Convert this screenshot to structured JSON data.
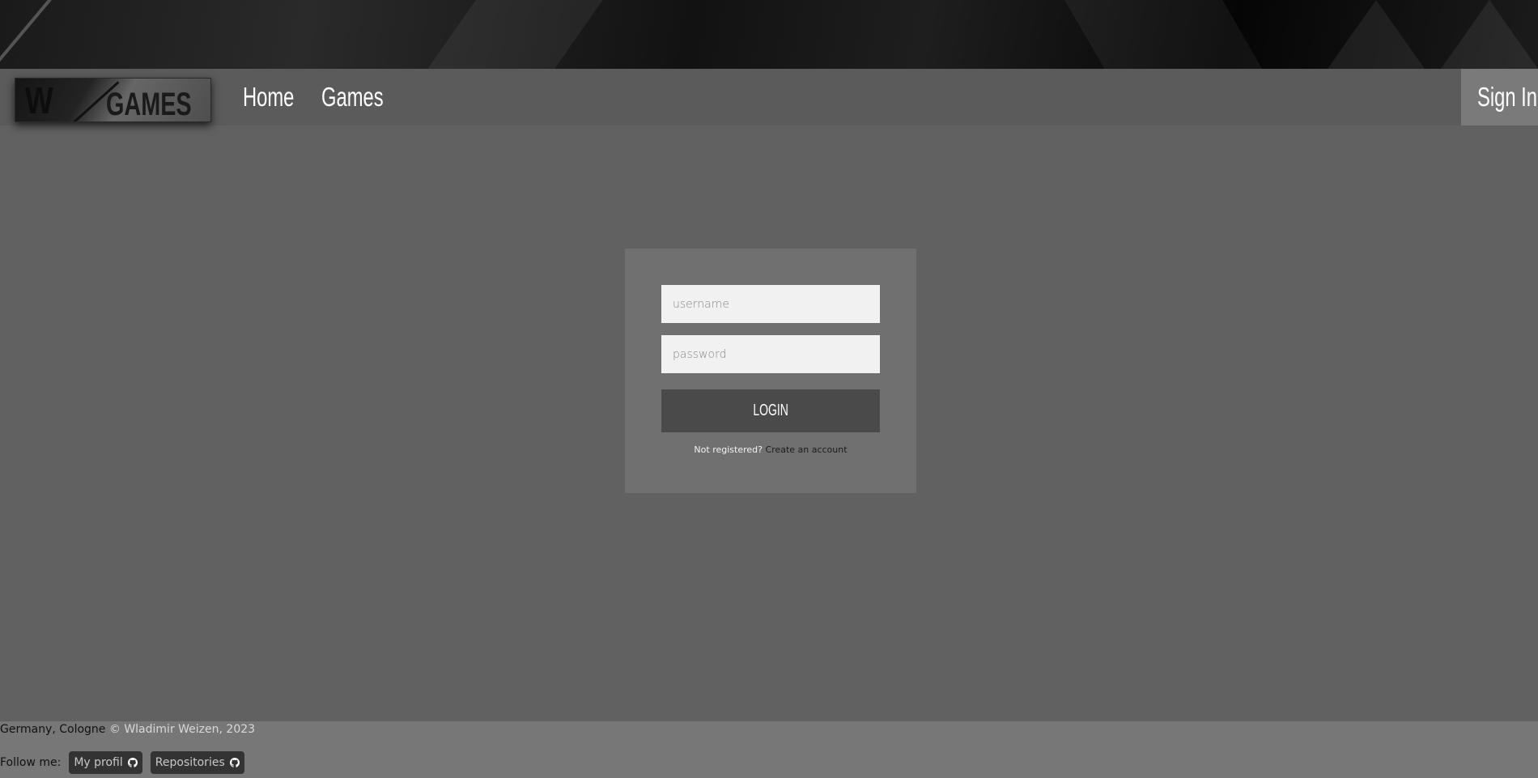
{
  "logo": {
    "letter": "W",
    "word": "GAMES"
  },
  "nav": {
    "home_label": "Home",
    "games_label": "Games",
    "signin_label": "Sign In"
  },
  "login": {
    "username_placeholder": "username",
    "password_placeholder": "password",
    "button_label": "LOGIN",
    "not_registered": "Not registered?",
    "create_account": "Create an account"
  },
  "footer": {
    "location": "Germany, Cologne",
    "copyright": "© Wladimir Weizen, 2023",
    "follow_label": "Follow me:",
    "profile_label": "My profil",
    "repositories_label": "Repositories",
    "link_icon": "github-icon"
  },
  "colors": {
    "page_bg": "#616161",
    "nav_bg": "#5b5b5b",
    "card_bg": "#707070",
    "button_bg": "#4a4a4a",
    "footer_bg": "#777777"
  }
}
